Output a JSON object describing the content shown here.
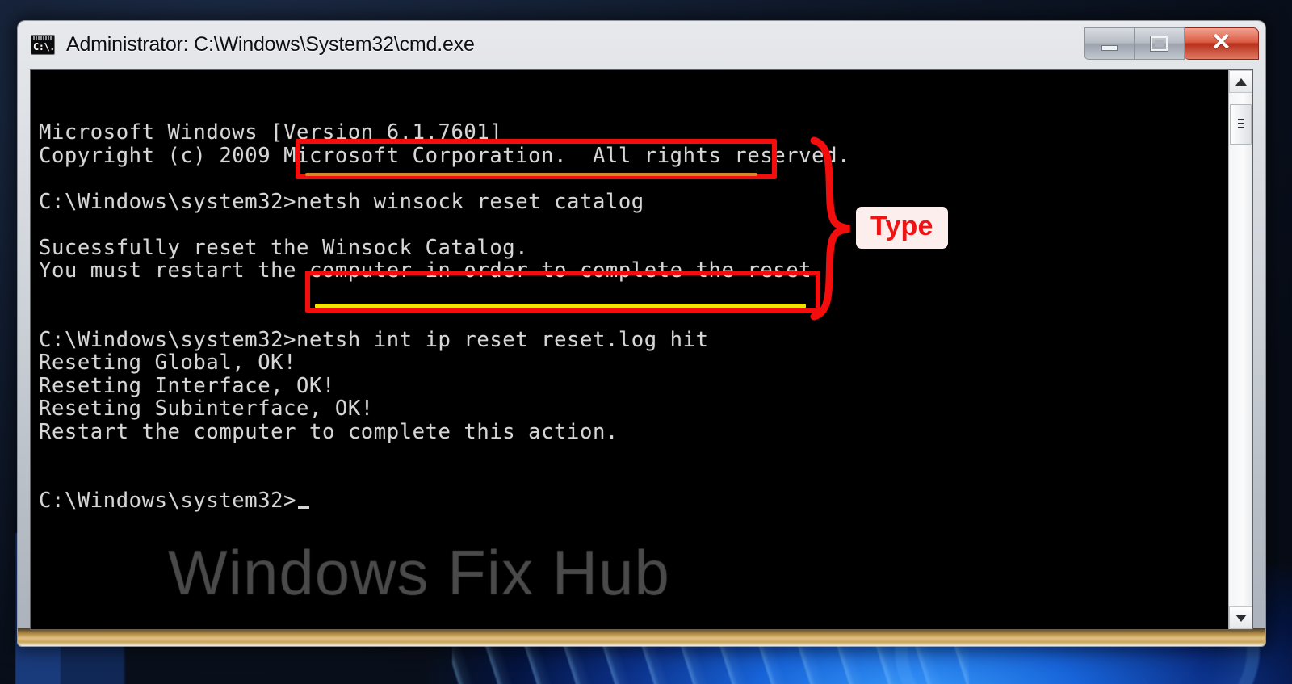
{
  "window": {
    "title": "Administrator: C:\\Windows\\System32\\cmd.exe",
    "icon_name": "cmd-icon",
    "icon_glyph": "C:\\.",
    "buttons": {
      "minimize_label": "–",
      "maximize_label": "□",
      "close_label": "✕"
    },
    "colors": {
      "frame": "#cfd4da",
      "console_bg": "#000000",
      "console_fg": "#d6d6d6",
      "close_button": "#b8301b",
      "gold_edge": "#e0c184"
    }
  },
  "console": {
    "lines": [
      "Microsoft Windows [Version 6.1.7601]",
      "Copyright (c) 2009 Microsoft Corporation.  All rights reserved.",
      "",
      "C:\\Windows\\system32>netsh winsock reset catalog",
      "",
      "Sucessfully reset the Winsock Catalog.",
      "You must restart the computer in order to complete the reset.",
      "",
      "",
      "C:\\Windows\\system32>netsh int ip reset reset.log hit",
      "Reseting Global, OK!",
      "Reseting Interface, OK!",
      "Reseting Subinterface, OK!",
      "Restart the computer to complete this action.",
      "",
      "",
      "C:\\Windows\\system32>"
    ],
    "watermark": "Windows Fix Hub",
    "cursor_visible": true
  },
  "scrollbar": {
    "up_arrow": "▲",
    "down_arrow": "▼",
    "thumb_position": "top"
  },
  "annotations": {
    "badge_label": "Type",
    "badge_color": "#f01313",
    "badge_bg": "#fdeeee",
    "box_color": "#f40d0d",
    "underline_color": "#f2e205",
    "highlighted_commands": [
      "netsh winsock reset catalog",
      "netsh int ip reset reset.log hit"
    ]
  }
}
